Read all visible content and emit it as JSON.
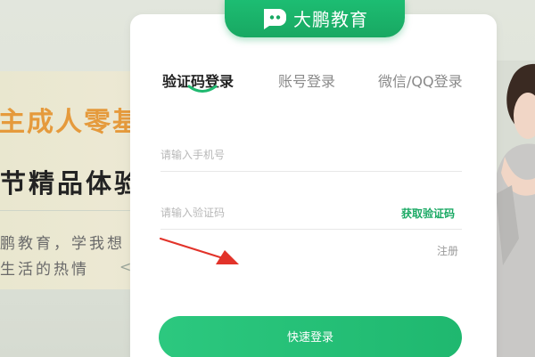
{
  "background": {
    "headline_fragment": "主成人零基",
    "subheadline_fragment": "节精品体验",
    "body_line1": "鹏教育，学我想",
    "body_line2": "生活的热情",
    "body_glyph": "<"
  },
  "brand": {
    "name": "大鹏教育",
    "accent_color": "#1aa964",
    "logo_icon": "dp-chat-logo-icon"
  },
  "tabs": [
    {
      "label": "验证码登录",
      "active": true
    },
    {
      "label": "账号登录",
      "active": false
    },
    {
      "label": "微信/QQ登录",
      "active": false
    }
  ],
  "form": {
    "phone_placeholder": "请输入手机号",
    "code_placeholder": "请输入验证码",
    "get_code_label": "获取验证码",
    "register_label": "注册",
    "submit_label": "快速登录"
  },
  "annotation": {
    "arrow_icon": "red-pointer-arrow-icon",
    "arrow_color": "#e2332a"
  }
}
